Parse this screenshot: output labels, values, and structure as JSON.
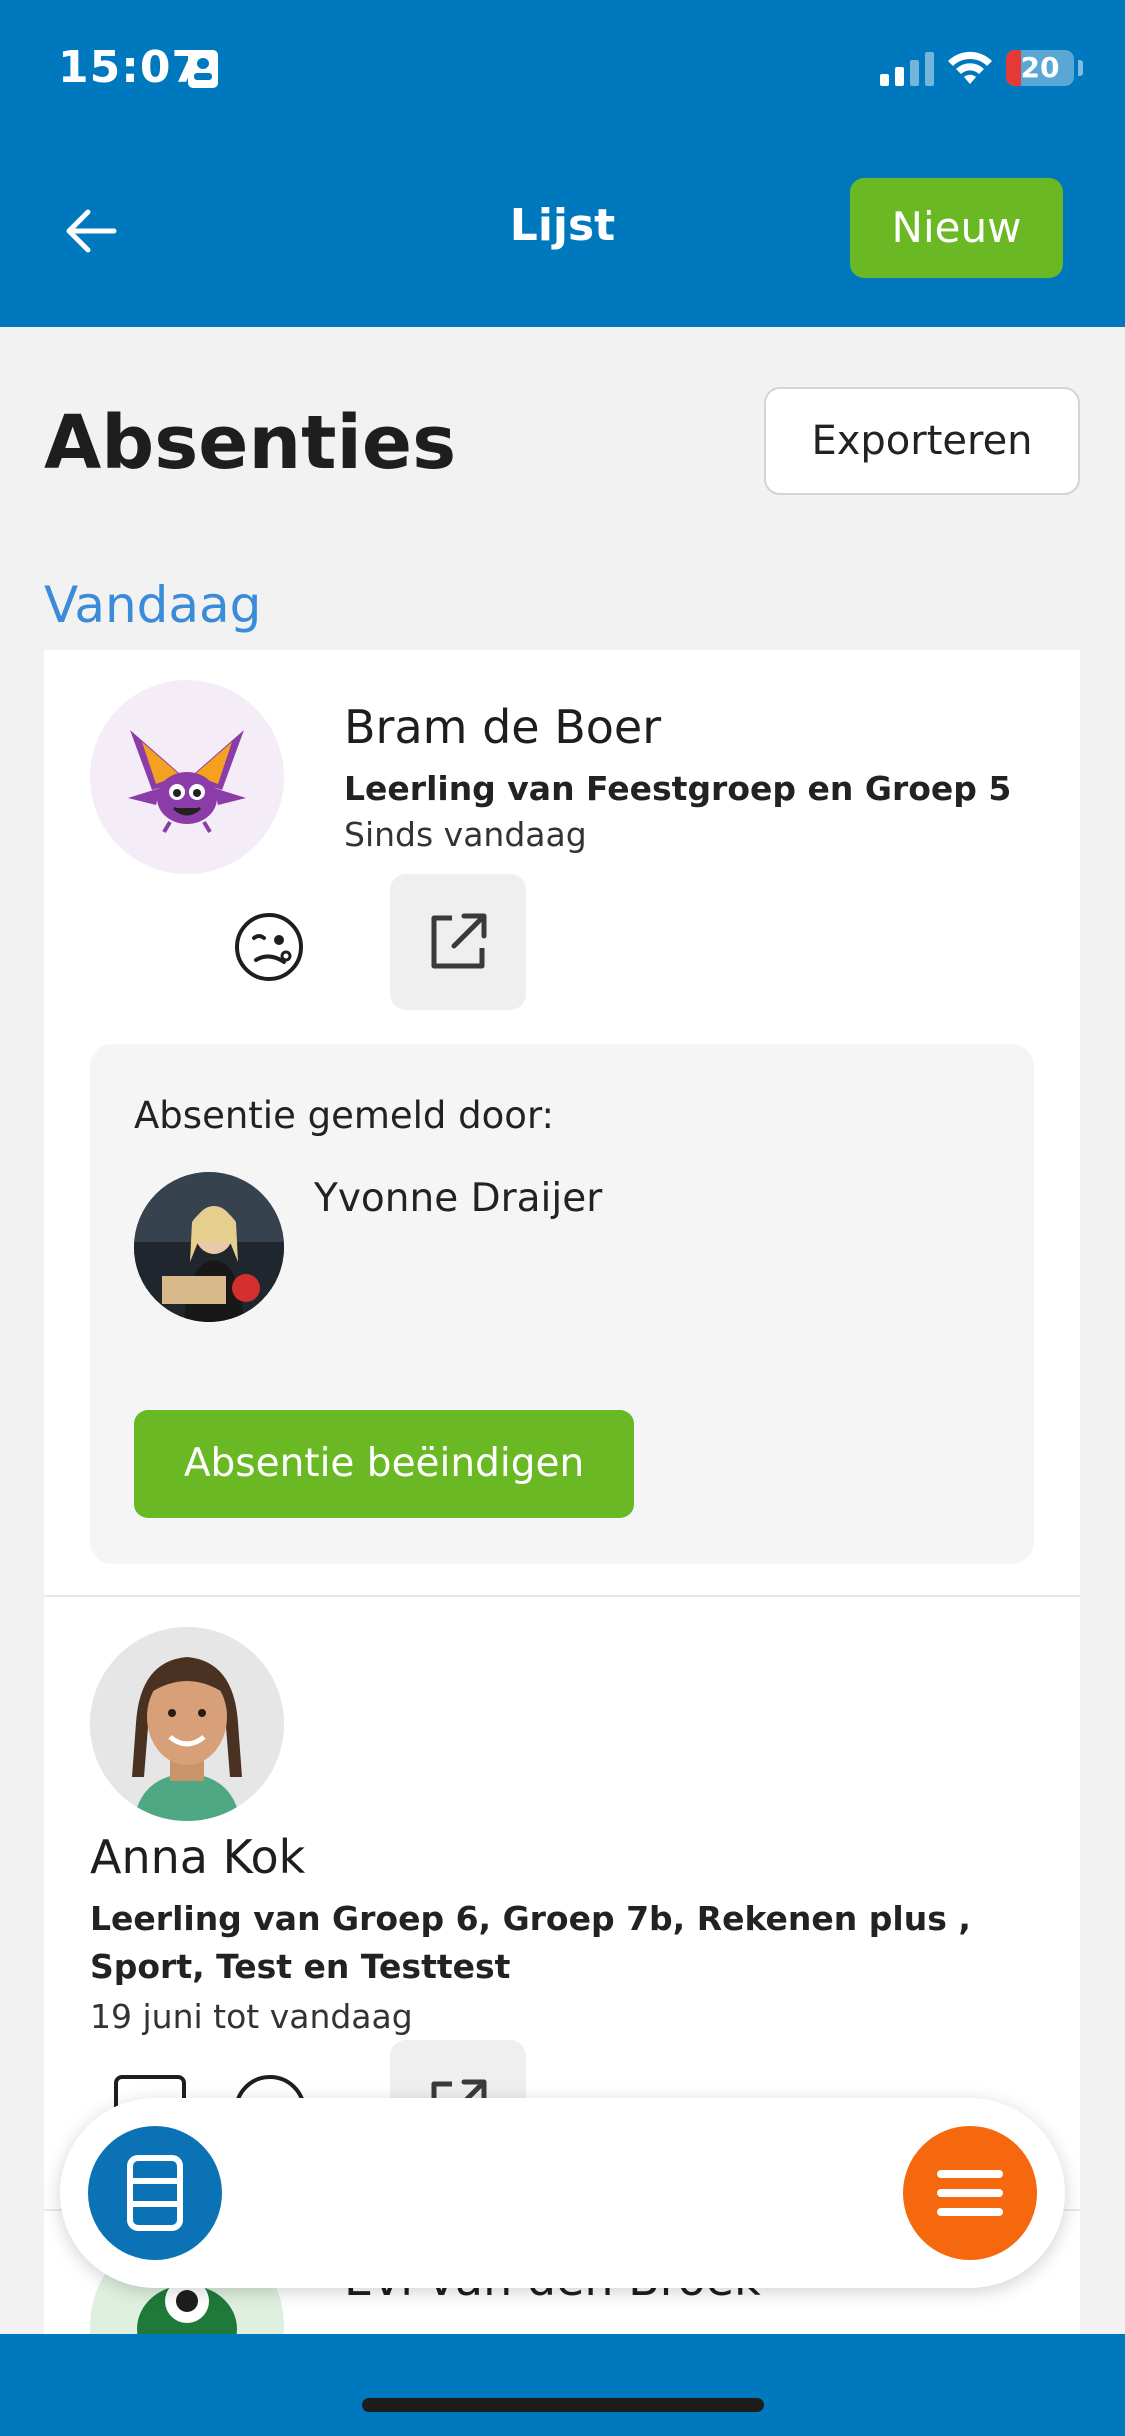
{
  "status_bar": {
    "time": "15:07",
    "battery": "20",
    "signal_bars": 2,
    "icons": [
      "contact-card-icon",
      "signal-icon",
      "wifi-icon",
      "battery-icon"
    ]
  },
  "nav": {
    "title": "Lijst",
    "new_label": "Nieuw",
    "back_icon": "arrow-left-icon"
  },
  "page": {
    "title": "Absenties",
    "export_label": "Exporteren",
    "section_today": "Vandaag"
  },
  "absences": [
    {
      "name": "Bram de Boer",
      "groups": "Leerling van Feestgroep en Groep 5",
      "period": "Sinds vandaag",
      "reason_icon": "sick-face-icon",
      "reported_by_label": "Absentie gemeld door:",
      "reporter": "Yvonne Draijer",
      "end_label": "Absentie beëindigen"
    },
    {
      "name": "Anna Kok",
      "groups": "Leerling van Groep 6, Groep 7b, Rekenen plus , Sport, Test en Testtest",
      "period": "19 juni tot vandaag"
    },
    {
      "name": "Evi van den Broek"
    }
  ],
  "colors": {
    "header": "#0078be",
    "primary_green": "#6ab824",
    "section_blue": "#3a8bd8",
    "fab_orange": "#f5680e",
    "fab_blue": "#0b72b5"
  },
  "bottom_bar": {
    "left_icon": "cabinet-icon",
    "right_icon": "menu-icon"
  }
}
